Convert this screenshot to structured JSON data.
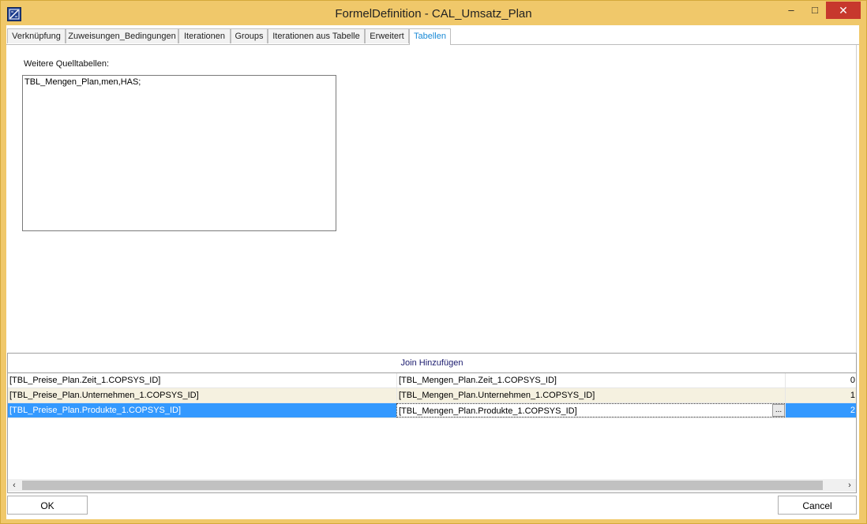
{
  "window": {
    "title": "FormelDefinition - CAL_Umsatz_Plan",
    "minimize": "–",
    "maximize": "□",
    "close": "✕",
    "icon": "formula-icon",
    "accent_color": "#f0c86a",
    "close_color": "#c7382d"
  },
  "tabs": [
    {
      "label": "Verknüpfung"
    },
    {
      "label": "Zuweisungen_Bedingungen"
    },
    {
      "label": "Iterationen"
    },
    {
      "label": "Groups"
    },
    {
      "label": "Iterationen aus Tabelle"
    },
    {
      "label": "Erweitert"
    },
    {
      "label": "Tabellen",
      "active": true
    }
  ],
  "tabellen": {
    "quell_label": "Weitere Quelltabellen:",
    "quell_value": "TBL_Mengen_Plan,men,HAS;"
  },
  "join": {
    "header": "Join Hinzufügen",
    "rows": [
      {
        "left": "[TBL_Preise_Plan.Zeit_1.COPSYS_ID]",
        "right": "[TBL_Mengen_Plan.Zeit_1.COPSYS_ID]",
        "index": "0"
      },
      {
        "left": "[TBL_Preise_Plan.Unternehmen_1.COPSYS_ID]",
        "right": "[TBL_Mengen_Plan.Unternehmen_1.COPSYS_ID]",
        "index": "1"
      },
      {
        "left": "[TBL_Preise_Plan.Produkte_1.COPSYS_ID]",
        "right": "[TBL_Mengen_Plan.Produkte_1.COPSYS_ID]",
        "index": "2",
        "selected": true
      }
    ],
    "ellipsis": "...",
    "scroll_left": "‹",
    "scroll_right": "›",
    "selection_color": "#3399ff"
  },
  "footer": {
    "ok_label": "OK",
    "cancel_label": "Cancel"
  }
}
